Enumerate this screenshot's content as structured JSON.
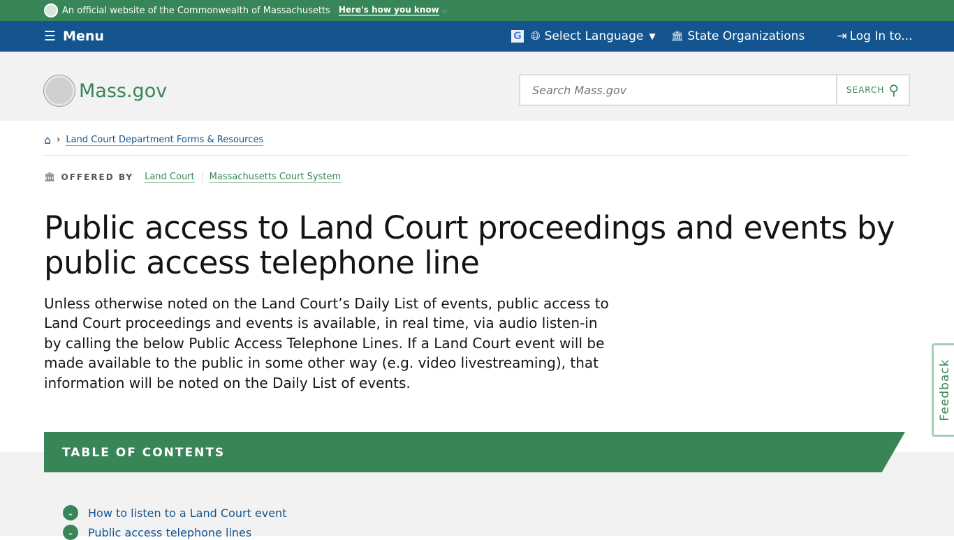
{
  "topbar": {
    "official_text": "An official website of the Commonwealth of Massachusetts",
    "how_link": "Here's how you know"
  },
  "nav": {
    "menu": "Menu",
    "language": "Select Language",
    "state_orgs": "State Organizations",
    "login": "Log In to..."
  },
  "header": {
    "logo_text": "Mass.gov",
    "search_placeholder": "Search Mass.gov",
    "search_button": "SEARCH"
  },
  "breadcrumb": {
    "item": "Land Court Department Forms & Resources"
  },
  "offered_by": {
    "label": "OFFERED BY",
    "orgs": [
      "Land Court",
      "Massachusetts Court System"
    ]
  },
  "page": {
    "title": "Public access to Land Court proceedings and events by public access telephone line",
    "lede": "Unless otherwise noted on the Land Court’s Daily List of events, public access to Land Court proceedings and events is available, in real time, via audio listen-in by calling the below Public Access Telephone Lines. If a Land Court event will be made available to the public in some other way (e.g. video livestreaming), that information will be noted on the Daily List of events."
  },
  "toc": {
    "heading": "TABLE OF CONTENTS",
    "items": [
      "How to listen to a Land Court event",
      "Public access telephone lines"
    ]
  },
  "feedback": "Feedback"
}
